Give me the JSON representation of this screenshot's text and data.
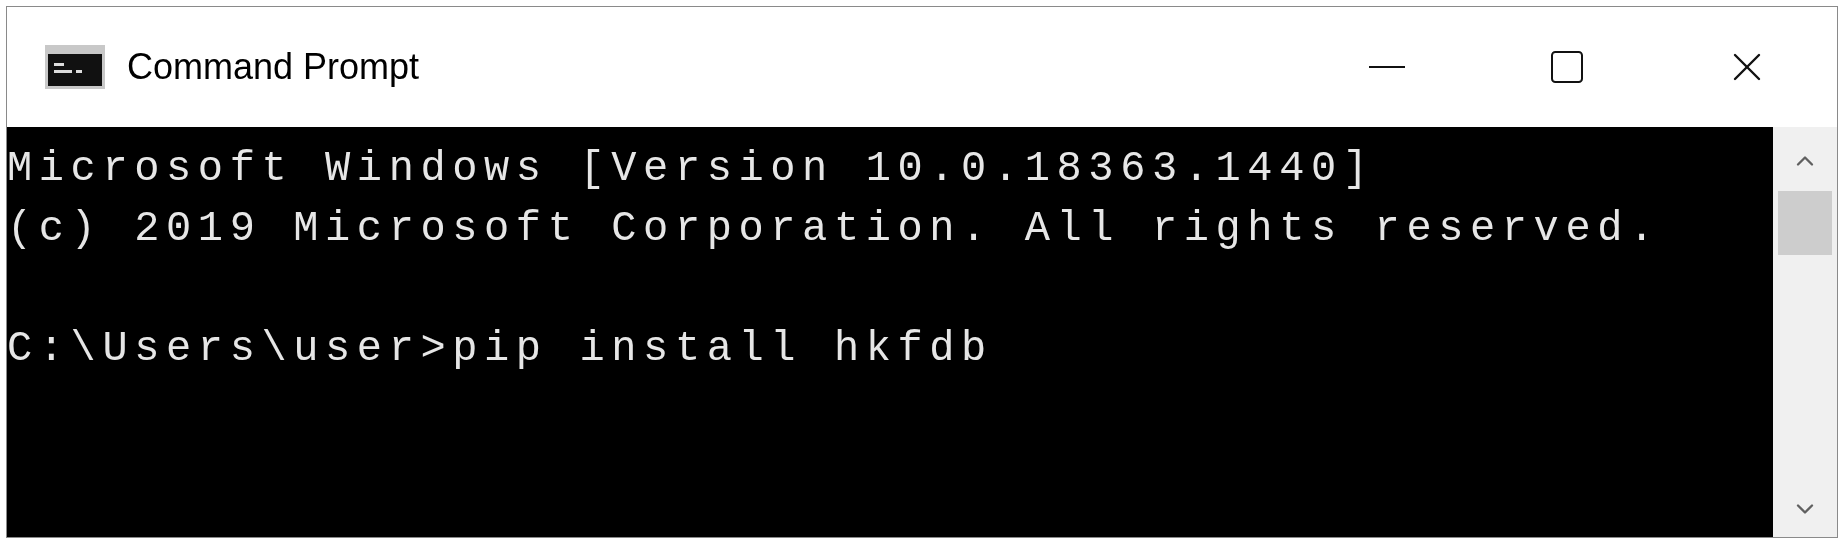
{
  "window": {
    "title": "Command Prompt"
  },
  "terminal": {
    "output": [
      "Microsoft Windows [Version 10.0.18363.1440]",
      "(c) 2019 Microsoft Corporation. All rights reserved."
    ],
    "input_line": "C:\\Users\\user>pip install hkfdb"
  }
}
